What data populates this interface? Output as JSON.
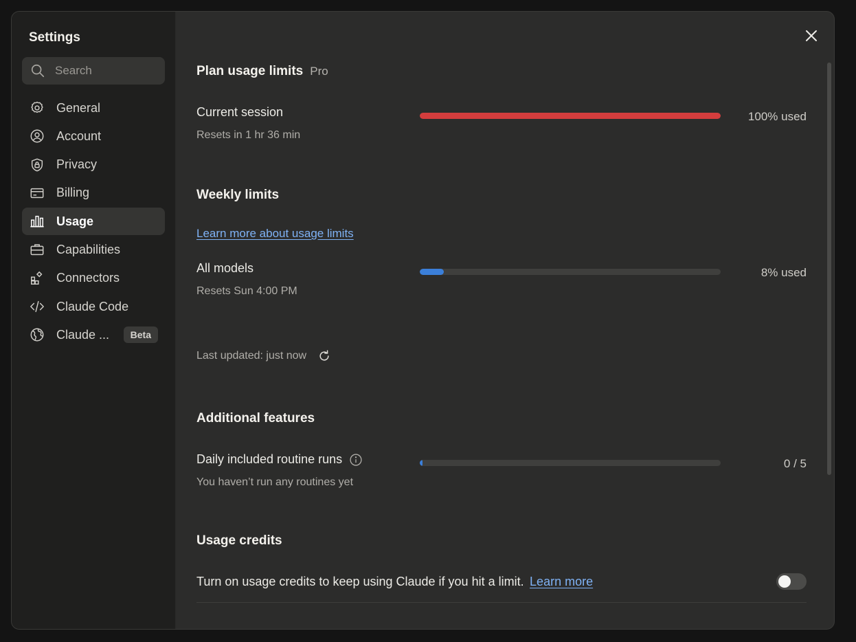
{
  "sidebar": {
    "title": "Settings",
    "search_placeholder": "Search",
    "items": [
      {
        "label": "General",
        "icon": "gear-icon"
      },
      {
        "label": "Account",
        "icon": "user-circle-icon"
      },
      {
        "label": "Privacy",
        "icon": "shield-lock-icon"
      },
      {
        "label": "Billing",
        "icon": "credit-card-icon"
      },
      {
        "label": "Usage",
        "icon": "bar-chart-icon",
        "active": true
      },
      {
        "label": "Capabilities",
        "icon": "briefcase-icon"
      },
      {
        "label": "Connectors",
        "icon": "connectors-icon"
      },
      {
        "label": "Claude Code",
        "icon": "code-icon"
      },
      {
        "label": "Claude ...",
        "icon": "globe-icon",
        "badge": "Beta"
      }
    ]
  },
  "main": {
    "plan": {
      "title": "Plan usage limits",
      "tag": "Pro",
      "current_session": {
        "title": "Current session",
        "subtitle": "Resets in 1 hr 36 min",
        "percent": 100,
        "label": "100% used",
        "color": "#d43d3d"
      }
    },
    "weekly": {
      "title": "Weekly limits",
      "link": "Learn more about usage limits",
      "all_models": {
        "title": "All models",
        "subtitle": "Resets Sun 4:00 PM",
        "percent": 8,
        "label": "8% used",
        "color": "#3b7fd9"
      },
      "last_updated": "Last updated: just now"
    },
    "additional": {
      "title": "Additional features",
      "routines": {
        "title": "Daily included routine runs",
        "subtitle": "You haven’t run any routines yet",
        "used": 0,
        "total": 5,
        "label": "0 / 5",
        "color": "#3b7fd9"
      }
    },
    "credits": {
      "title": "Usage credits",
      "description": "Turn on usage credits to keep using Claude if you hit a limit.",
      "link": "Learn more",
      "toggle_on": false
    }
  }
}
